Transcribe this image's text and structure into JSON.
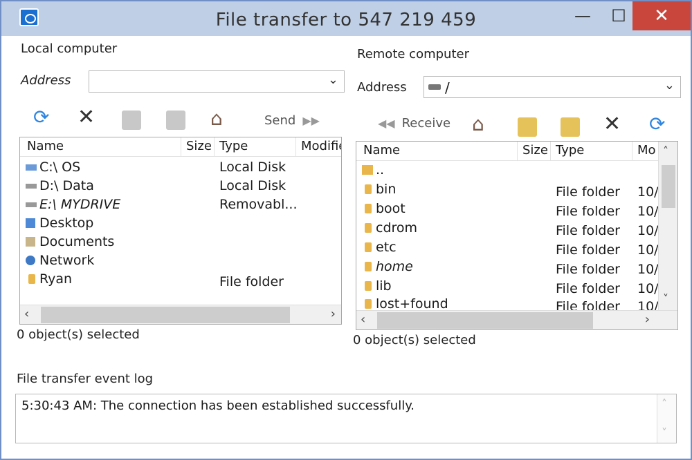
{
  "window": {
    "title": "File transfer to 547 219 459",
    "minimize": "—",
    "maximize": "☐",
    "close": "✕"
  },
  "local": {
    "heading": "Local computer",
    "address_label": "Address",
    "address_value": "",
    "send_label": "Send",
    "columns": [
      "Name",
      "Size",
      "Type",
      "Modifie"
    ],
    "rows": [
      {
        "icon": "drive",
        "name": "C:\\  OS",
        "type": "Local Disk"
      },
      {
        "icon": "gdrive",
        "name": "D:\\  Data",
        "type": "Local Disk"
      },
      {
        "icon": "gdrive",
        "name": "E:\\  MYDRIVE",
        "type": "Removabl..."
      },
      {
        "icon": "desk",
        "name": "Desktop",
        "type": ""
      },
      {
        "icon": "docs",
        "name": "Documents",
        "type": ""
      },
      {
        "icon": "globe",
        "name": "Network",
        "type": ""
      },
      {
        "icon": "folder",
        "name": "Ryan",
        "type": "File folder"
      }
    ],
    "status": "0 object(s) selected"
  },
  "remote": {
    "heading": "Remote computer",
    "address_label": "Address",
    "address_value": "/",
    "receive_label": "Receive",
    "columns": [
      "Name",
      "Size",
      "Type",
      "Mo"
    ],
    "rows": [
      {
        "icon": "up",
        "name": "..",
        "type": "",
        "mod": ""
      },
      {
        "icon": "folder",
        "name": "bin",
        "type": "File folder",
        "mod": "10/"
      },
      {
        "icon": "folder",
        "name": "boot",
        "type": "File folder",
        "mod": "10/"
      },
      {
        "icon": "folder",
        "name": "cdrom",
        "type": "File folder",
        "mod": "10/"
      },
      {
        "icon": "folder",
        "name": "etc",
        "type": "File folder",
        "mod": "10/"
      },
      {
        "icon": "folder",
        "name": "home",
        "type": "File folder",
        "mod": "10/"
      },
      {
        "icon": "folder",
        "name": "lib",
        "type": "File folder",
        "mod": "10/"
      },
      {
        "icon": "folder",
        "name": "lost+found",
        "type": "File folder",
        "mod": "10/"
      }
    ],
    "status": "0 object(s) selected"
  },
  "log": {
    "label": "File transfer event log",
    "entries": [
      "5:30:43 AM: The connection has been established successfully."
    ]
  },
  "colors": {
    "titlebar": "#bfcfe6",
    "close": "#c9463d",
    "accent": "#2f86e0"
  }
}
